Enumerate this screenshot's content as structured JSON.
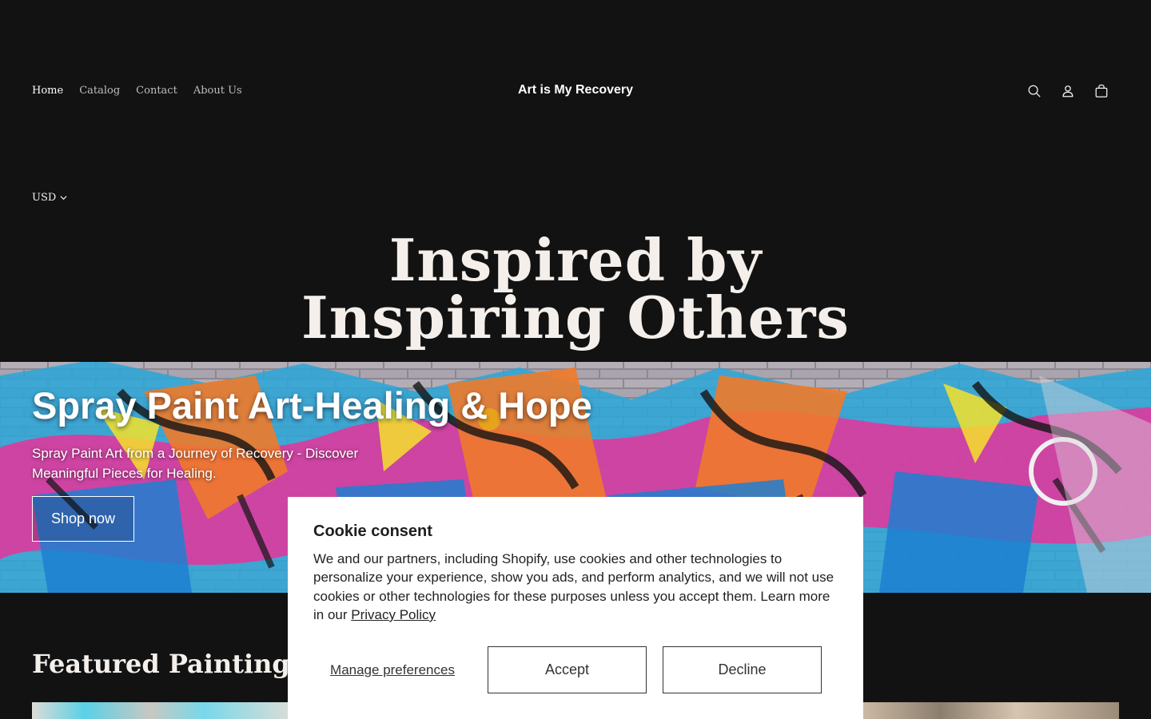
{
  "header": {
    "nav": [
      {
        "label": "Home",
        "active": true
      },
      {
        "label": "Catalog",
        "active": false
      },
      {
        "label": "Contact",
        "active": false
      },
      {
        "label": "About Us",
        "active": false
      }
    ],
    "brand": "Art is My Recovery",
    "icons": [
      "search-icon",
      "account-icon",
      "cart-icon"
    ],
    "currency": "USD"
  },
  "hero": {
    "title_line1": "Inspired by",
    "title_line2": "Inspiring Others"
  },
  "banner": {
    "title": "Spray Paint Art-Healing & Hope",
    "subtitle": "Spray Paint Art from a Journey of Recovery - Discover Meaningful Pieces for Healing.",
    "cta": "Shop now"
  },
  "featured": {
    "heading": "Featured Paintings"
  },
  "cookie": {
    "title": "Cookie consent",
    "body": "We and our partners, including Shopify, use cookies and other technologies to personalize your experience, show you ads, and perform analytics, and we will not use cookies or other technologies for these purposes unless you accept them. Learn more in our ",
    "privacy_link": "Privacy Policy",
    "manage": "Manage preferences",
    "accept": "Accept",
    "decline": "Decline"
  },
  "colors": {
    "background": "#121212",
    "text": "#f2f2f2",
    "modal": "#ffffff"
  }
}
